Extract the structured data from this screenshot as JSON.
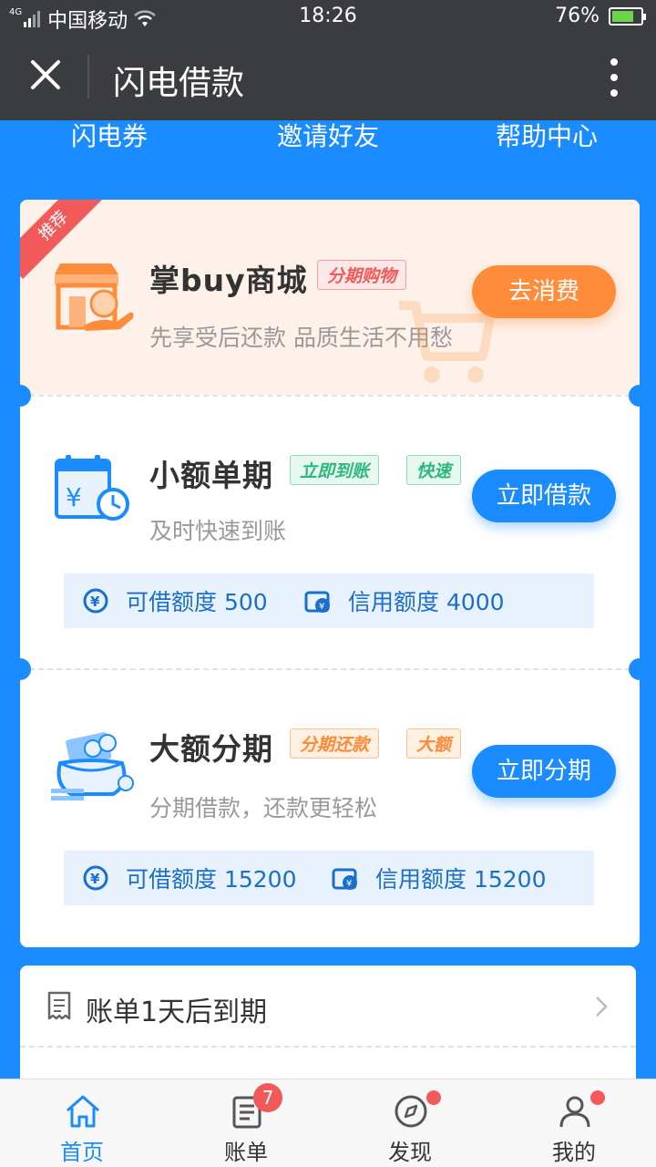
{
  "status_bar": {
    "network": "4G",
    "carrier": "中国移动",
    "time": "18:26",
    "battery": "76%",
    "battery_level": 0.76
  },
  "app_bar": {
    "title": "闪电借款",
    "close_icon": "close-icon",
    "more_icon": "more-vertical-icon"
  },
  "top_menu": [
    "闪电券",
    "邀请好友",
    "帮助中心"
  ],
  "mall": {
    "ribbon": "推荐",
    "title": "掌buy商城",
    "tag": "分期购物",
    "subtitle": "先享受后还款 品质生活不用愁",
    "button": "去消费",
    "icon": "shop-icon"
  },
  "small_loan": {
    "title": "小额单期",
    "tags": [
      "立即到账",
      "快速"
    ],
    "subtitle": "及时快速到账",
    "button": "立即借款",
    "icon": "calendar-clock-icon",
    "quota": {
      "available_label": "可借额度 500",
      "credit_label": "信用额度 4000"
    }
  },
  "large_loan": {
    "title": "大额分期",
    "tags": [
      "分期还款",
      "大额"
    ],
    "subtitle": "分期借款，还款更轻松",
    "button": "立即分期",
    "icon": "money-bag-icon",
    "quota": {
      "available_label": "可借额度 15200",
      "credit_label": "信用额度 15200"
    }
  },
  "bill": {
    "text": "账单1天后到期",
    "icon": "bill-icon"
  },
  "bottom_nav": [
    {
      "label": "首页",
      "icon": "home-icon",
      "active": true
    },
    {
      "label": "账单",
      "icon": "bill-icon",
      "badge": "7"
    },
    {
      "label": "发现",
      "icon": "compass-icon",
      "dot": true
    },
    {
      "label": "我的",
      "icon": "user-icon",
      "dot": true
    }
  ],
  "colors": {
    "primary": "#1a8cff",
    "orange": "#ff8c3a",
    "red": "#f25a5a",
    "green": "#2db87d",
    "header": "#3a3c40"
  }
}
